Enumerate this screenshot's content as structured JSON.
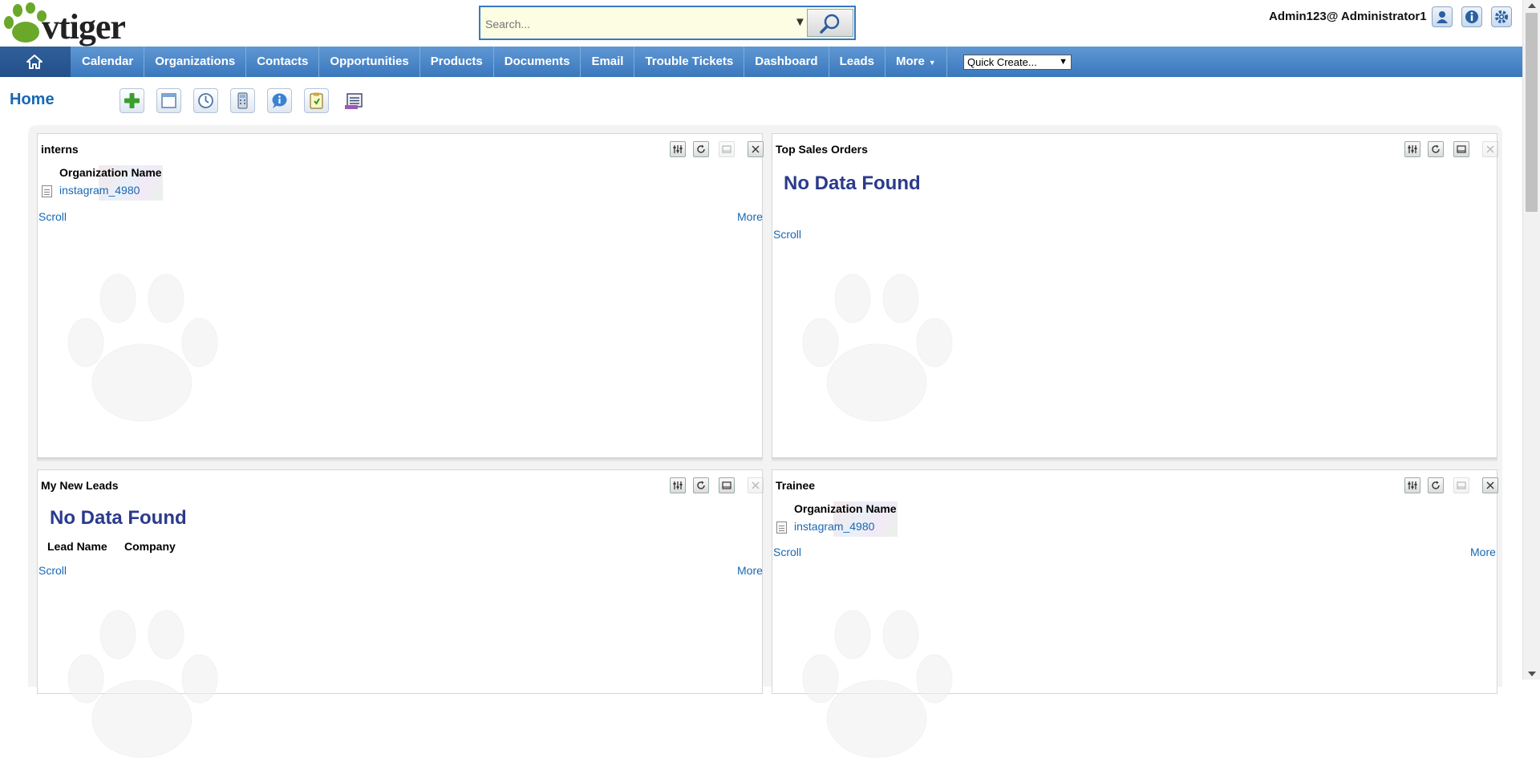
{
  "app": {
    "logo_text": "vtiger"
  },
  "search": {
    "placeholder": "Search..."
  },
  "user": {
    "label": "Admin123@ Administrator1"
  },
  "nav": {
    "items": [
      "Calendar",
      "Organizations",
      "Contacts",
      "Opportunities",
      "Products",
      "Documents",
      "Email",
      "Trouble Tickets",
      "Dashboard",
      "Leads",
      "More"
    ],
    "quick_create": "Quick Create..."
  },
  "page": {
    "title": "Home"
  },
  "widgets": {
    "interns": {
      "title": "interns",
      "column": "Organization Name",
      "rows": [
        "instagram_4980"
      ],
      "scroll": "Scroll",
      "more": "More"
    },
    "top_sales": {
      "title": "Top Sales Orders",
      "empty": "No Data Found",
      "scroll": "Scroll"
    },
    "new_leads": {
      "title": "My New Leads",
      "empty": "No Data Found",
      "columns": [
        "Lead Name",
        "Company"
      ],
      "scroll": "Scroll",
      "more": "More"
    },
    "trainee": {
      "title": "Trainee",
      "column": "Organization Name",
      "rows": [
        "instagram_4980"
      ],
      "scroll": "Scroll",
      "more": "More"
    }
  },
  "colors": {
    "nav_bg": "#4a88c9",
    "link": "#1767b3",
    "no_data": "#2a3a8c",
    "title_blue": "#1767b3"
  }
}
